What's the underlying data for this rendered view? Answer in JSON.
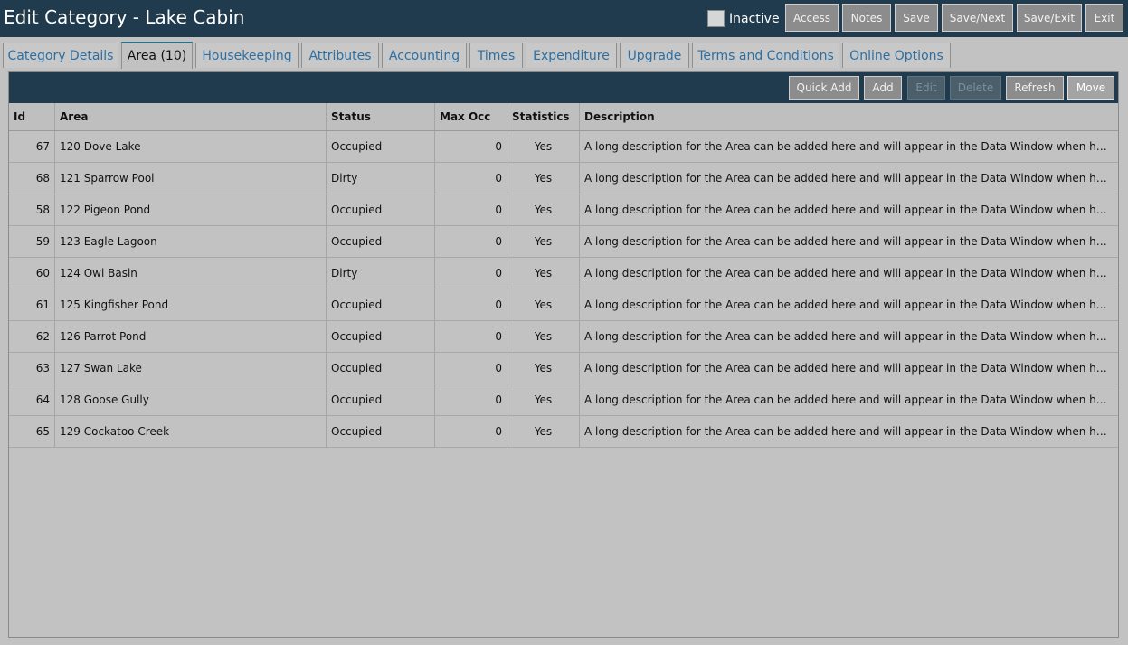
{
  "header": {
    "title": "Edit Category - Lake Cabin",
    "inactive_label": "Inactive",
    "buttons": {
      "access": "Access",
      "notes": "Notes",
      "save": "Save",
      "save_next": "Save/Next",
      "save_exit": "Save/Exit",
      "exit": "Exit"
    }
  },
  "tabs": [
    {
      "label": "Category Details"
    },
    {
      "label": "Area (10)"
    },
    {
      "label": "Housekeeping"
    },
    {
      "label": "Attributes"
    },
    {
      "label": "Accounting"
    },
    {
      "label": "Times"
    },
    {
      "label": "Expenditure"
    },
    {
      "label": "Upgrade"
    },
    {
      "label": "Terms and Conditions"
    },
    {
      "label": "Online Options"
    }
  ],
  "toolbar": {
    "quick_add": "Quick Add",
    "add": "Add",
    "edit": "Edit",
    "delete": "Delete",
    "refresh": "Refresh",
    "move": "Move"
  },
  "table": {
    "columns": {
      "id": "Id",
      "area": "Area",
      "status": "Status",
      "max_occ": "Max Occ",
      "statistics": "Statistics",
      "description": "Description"
    },
    "rows": [
      {
        "id": "67",
        "area": "120 Dove Lake",
        "status": "Occupied",
        "max_occ": "0",
        "statistics": "Yes",
        "description": "A long description for the Area can be added here and will appear in the Data Window when hovering ..."
      },
      {
        "id": "68",
        "area": "121 Sparrow Pool",
        "status": "Dirty",
        "max_occ": "0",
        "statistics": "Yes",
        "description": "A long description for the Area can be added here and will appear in the Data Window when hovering ..."
      },
      {
        "id": "58",
        "area": "122 Pigeon Pond",
        "status": "Occupied",
        "max_occ": "0",
        "statistics": "Yes",
        "description": "A long description for the Area can be added here and will appear in the Data Window when hovering ..."
      },
      {
        "id": "59",
        "area": "123 Eagle Lagoon",
        "status": "Occupied",
        "max_occ": "0",
        "statistics": "Yes",
        "description": "A long description for the Area can be added here and will appear in the Data Window when hovering ..."
      },
      {
        "id": "60",
        "area": "124 Owl Basin",
        "status": "Dirty",
        "max_occ": "0",
        "statistics": "Yes",
        "description": "A long description for the Area can be added here and will appear in the Data Window when hovering ..."
      },
      {
        "id": "61",
        "area": "125 Kingfisher Pond",
        "status": "Occupied",
        "max_occ": "0",
        "statistics": "Yes",
        "description": "A long description for the Area can be added here and will appear in the Data Window when hovering ..."
      },
      {
        "id": "62",
        "area": "126 Parrot Pond",
        "status": "Occupied",
        "max_occ": "0",
        "statistics": "Yes",
        "description": "A long description for the Area can be added here and will appear in the Data Window when hovering ..."
      },
      {
        "id": "63",
        "area": "127 Swan Lake",
        "status": "Occupied",
        "max_occ": "0",
        "statistics": "Yes",
        "description": "A long description for the Area can be added here and will appear in the Data Window when hovering ..."
      },
      {
        "id": "64",
        "area": "128 Goose Gully",
        "status": "Occupied",
        "max_occ": "0",
        "statistics": "Yes",
        "description": "A long description for the Area can be added here and will appear in the Data Window when hovering ..."
      },
      {
        "id": "65",
        "area": "129 Cockatoo Creek",
        "status": "Occupied",
        "max_occ": "0",
        "statistics": "Yes",
        "description": "A long description for the Area can be added here and will appear in the Data Window when hovering ..."
      }
    ]
  }
}
